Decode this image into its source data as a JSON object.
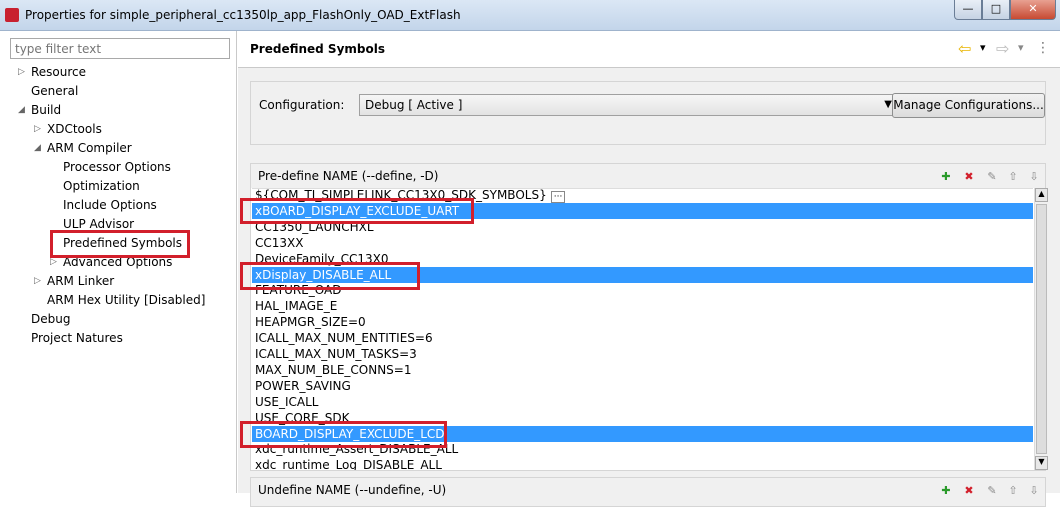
{
  "window": {
    "title": "Properties for simple_peripheral_cc1350lp_app_FlashOnly_OAD_ExtFlash",
    "minimize": "—",
    "maximize": "□",
    "close": "✕"
  },
  "filter": {
    "placeholder": "type filter text"
  },
  "tree": [
    {
      "label": "Resource",
      "level": 0,
      "twisty": "▷"
    },
    {
      "label": "General",
      "level": 0,
      "twisty": ""
    },
    {
      "label": "Build",
      "level": 0,
      "twisty": "◢"
    },
    {
      "label": "XDCtools",
      "level": 1,
      "twisty": "▷"
    },
    {
      "label": "ARM Compiler",
      "level": 1,
      "twisty": "◢"
    },
    {
      "label": "Processor Options",
      "level": 2,
      "twisty": ""
    },
    {
      "label": "Optimization",
      "level": 2,
      "twisty": ""
    },
    {
      "label": "Include Options",
      "level": 2,
      "twisty": ""
    },
    {
      "label": "ULP Advisor",
      "level": 2,
      "twisty": ""
    },
    {
      "label": "Predefined Symbols",
      "level": 2,
      "twisty": "",
      "selected": true
    },
    {
      "label": "Advanced Options",
      "level": 2,
      "twisty": "▷"
    },
    {
      "label": "ARM Linker",
      "level": 1,
      "twisty": "▷"
    },
    {
      "label": "ARM Hex Utility  [Disabled]",
      "level": 1,
      "twisty": ""
    },
    {
      "label": "Debug",
      "level": 0,
      "twisty": ""
    },
    {
      "label": "Project Natures",
      "level": 0,
      "twisty": ""
    }
  ],
  "page": {
    "title": "Predefined Symbols",
    "back": "⇦",
    "forward": "⇨",
    "menu": "⋮",
    "dropdown": "▾"
  },
  "config": {
    "label": "Configuration:",
    "value": "Debug  [ Active ]",
    "manage": "Manage Configurations..."
  },
  "define": {
    "header": "Pre-define NAME (--define, -D)",
    "more": "···",
    "items": [
      {
        "text": "${COM_TI_SIMPLELINK_CC13X0_SDK_SYMBOLS}"
      },
      {
        "text": "xBOARD_DISPLAY_EXCLUDE_UART",
        "selected": true
      },
      {
        "text": "CC1350_LAUNCHXL"
      },
      {
        "text": "CC13XX"
      },
      {
        "text": "DeviceFamily_CC13X0"
      },
      {
        "text": "xDisplay_DISABLE_ALL",
        "selected": true
      },
      {
        "text": "FEATURE_OAD"
      },
      {
        "text": "HAL_IMAGE_E"
      },
      {
        "text": "HEAPMGR_SIZE=0"
      },
      {
        "text": "ICALL_MAX_NUM_ENTITIES=6"
      },
      {
        "text": "ICALL_MAX_NUM_TASKS=3"
      },
      {
        "text": "MAX_NUM_BLE_CONNS=1"
      },
      {
        "text": "POWER_SAVING"
      },
      {
        "text": "USE_ICALL"
      },
      {
        "text": "USE_CORE_SDK"
      },
      {
        "text": "BOARD_DISPLAY_EXCLUDE_LCD",
        "selected": true
      },
      {
        "text": "xdc_runtime_Assert_DISABLE_ALL"
      },
      {
        "text": "xdc_runtime_Log_DISABLE_ALL"
      }
    ]
  },
  "undefine": {
    "header": "Undefine NAME (--undefine, -U)"
  },
  "colors": {
    "selection": "#3399ff",
    "highlight": "#d21f2b"
  }
}
